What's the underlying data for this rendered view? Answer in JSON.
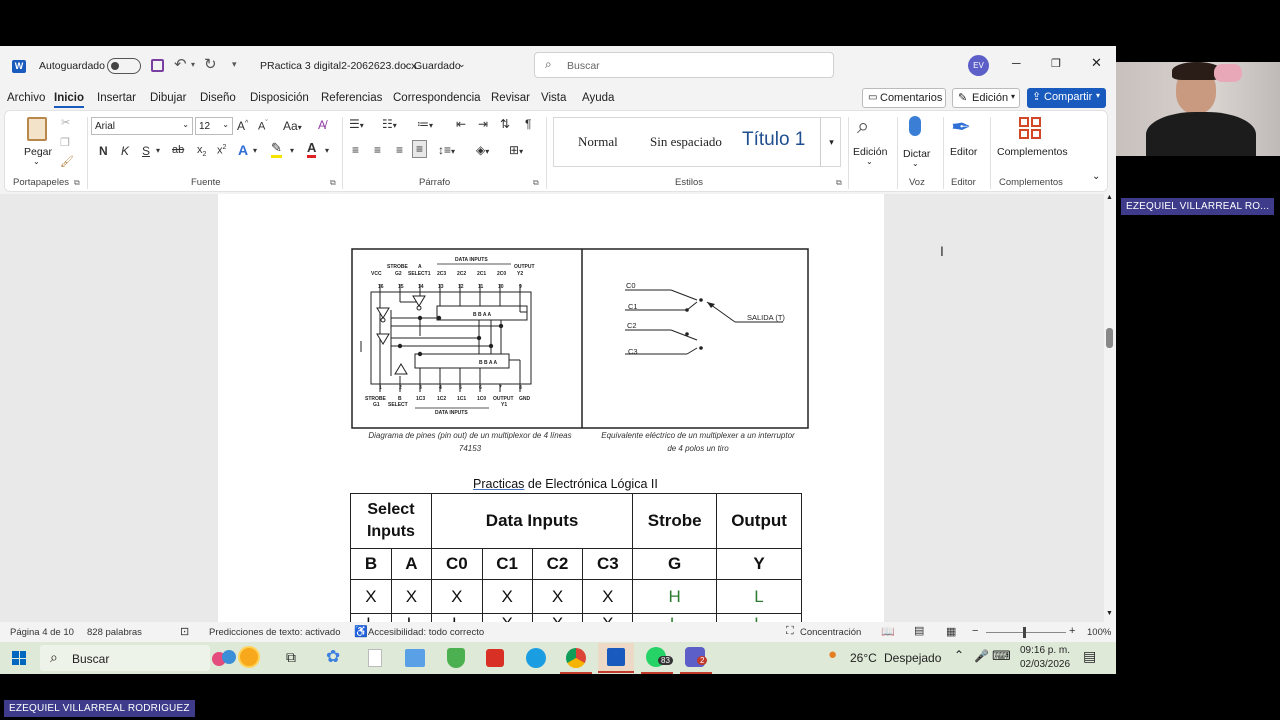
{
  "titlebar": {
    "autosave_label": "Autoguardado",
    "doc_title": "PRactica 3 digital2-2062623.docx",
    "saved_status": "Guardado",
    "search_placeholder": "Buscar",
    "avatar_initials": "EV"
  },
  "menu": {
    "items": [
      "Archivo",
      "Inicio",
      "Insertar",
      "Dibujar",
      "Diseño",
      "Disposición",
      "Referencias",
      "Correspondencia",
      "Revisar",
      "Vista",
      "Ayuda"
    ],
    "comments_label": "Comentarios",
    "edit_mode_label": "Edición",
    "share_label": "Compartir"
  },
  "ribbon": {
    "paste_label": "Pegar",
    "clipboard_group": "Portapapeles",
    "font_name": "Arial",
    "font_size": "12",
    "font_group": "Fuente",
    "paragraph_group": "Párrafo",
    "styles": [
      "Normal",
      "Sin espaciado",
      "Título 1"
    ],
    "styles_group": "Estilos",
    "edit_label": "Edición",
    "dictate_label": "Dictar",
    "voice_group": "Voz",
    "editor_label": "Editor",
    "editor_group": "Editor",
    "addins_label": "Complementos",
    "addins_group": "Complementos",
    "bold": "N",
    "italic": "K",
    "underline": "S",
    "strike": "ab",
    "font_color_accent": "#e02020",
    "highlight_accent": "#f5e400"
  },
  "document": {
    "pinout_top_labels": {
      "data_inputs": "DATA INPUTS",
      "output": "OUTPUT",
      "vcc": "VCC",
      "strobe": "STROBE",
      "g2": "G2",
      "a": "A",
      "select1": "SELECT1",
      "c3": "2C3",
      "c2": "2C2",
      "c1": "2C1",
      "c0": "2C0",
      "y2": "Y2"
    },
    "pin_numbers_top": [
      "16",
      "15",
      "14",
      "13",
      "12",
      "11",
      "10",
      "9"
    ],
    "pin_numbers_bottom": [
      "1",
      "2",
      "3",
      "4",
      "5",
      "6",
      "7",
      "8"
    ],
    "pinout_bottom_labels": {
      "strobe": "STROBE",
      "g1": "G1",
      "b": "B",
      "select": "SELECT",
      "c3": "1C3",
      "c2": "1C2",
      "c1": "1C1",
      "c0": "1C0",
      "output": "OUTPUT",
      "y1": "Y1",
      "gnd": "GND",
      "data_inputs": "DATA INPUTS"
    },
    "chip_pin_letters": "B B A A",
    "switch_labels": [
      "C0",
      "C1",
      "C2",
      "C3"
    ],
    "switch_output": "SALIDA (T)",
    "caption_left_1": "Diagrama de pines (pin out) de un multiplexor de 4 líneas",
    "caption_left_2": "74153",
    "caption_right_1": "Equivalente eléctrico  de un multiplexer a un interruptor",
    "caption_right_2": "de 4 polos un tiro",
    "heading_word1": "Practicas",
    "heading_rest": " de Electrónica Lógica II",
    "table_header": {
      "select": "Select Inputs",
      "data": "Data Inputs",
      "strobe": "Strobe",
      "output": "Output"
    },
    "table_sub": [
      "B",
      "A",
      "C0",
      "C1",
      "C2",
      "C3",
      "G",
      "Y"
    ],
    "table_row1": [
      "X",
      "X",
      "X",
      "X",
      "X",
      "X",
      "H",
      "L"
    ],
    "table_row2": [
      "L",
      "L",
      "L",
      "X",
      "X",
      "X",
      "L",
      "L"
    ],
    "row1_highlight_color": "#2e7d32"
  },
  "status": {
    "page": "Página 4 de 10",
    "words": "828 palabras",
    "predictions": "Predicciones de texto: activado",
    "accessibility": "Accesibilidad: todo correcto",
    "focus": "Concentración",
    "zoom": "100%"
  },
  "taskbar": {
    "search": "Buscar",
    "weather_temp": "26°C",
    "weather_desc": "Despejado",
    "time": "09:16 p. m.",
    "date": "02/03/2026",
    "whatsapp_badge": "83",
    "teams_badge": "2"
  },
  "participant": {
    "webcam_name": "EZEQUIEL VILLARREAL RO...",
    "bottom_name": "EZEQUIEL VILLARREAL RODRIGUEZ"
  }
}
